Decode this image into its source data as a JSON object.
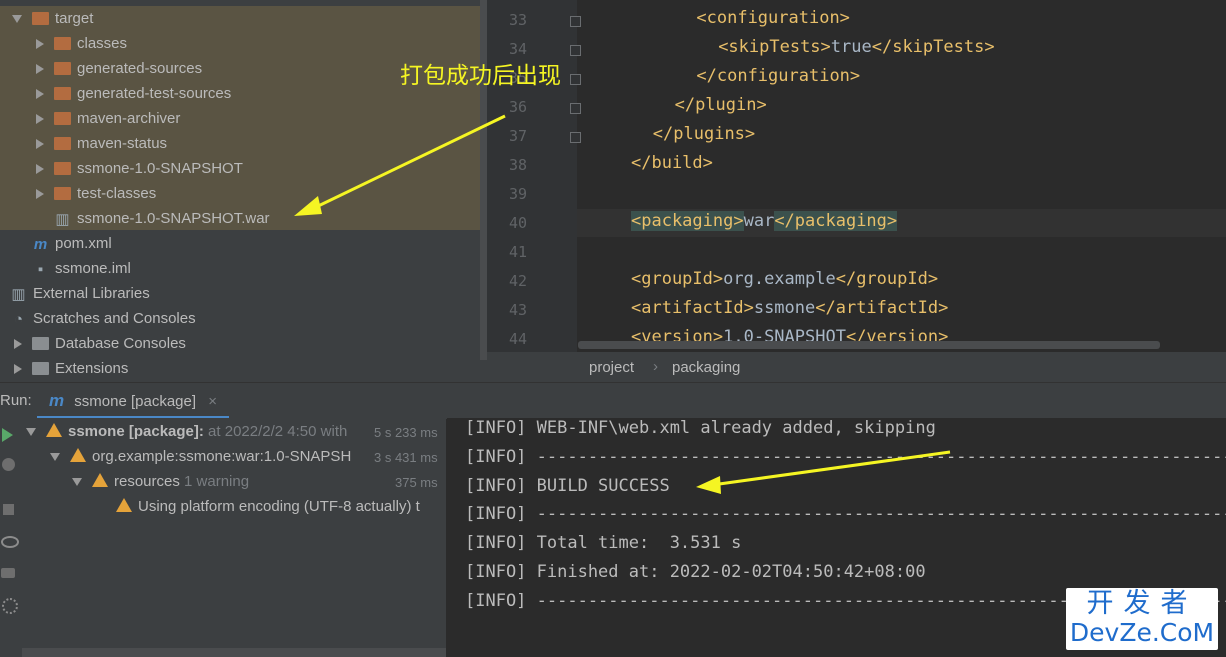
{
  "project_tree": {
    "items": [
      {
        "label": "target",
        "depth": 0,
        "arrow": "down",
        "icon": "folder-icon"
      },
      {
        "label": "classes",
        "depth": 1,
        "arrow": "right",
        "icon": "folder-icon"
      },
      {
        "label": "generated-sources",
        "depth": 1,
        "arrow": "right",
        "icon": "folder-icon"
      },
      {
        "label": "generated-test-sources",
        "depth": 1,
        "arrow": "right",
        "icon": "folder-icon"
      },
      {
        "label": "maven-archiver",
        "depth": 1,
        "arrow": "right",
        "icon": "folder-icon"
      },
      {
        "label": "maven-status",
        "depth": 1,
        "arrow": "right",
        "icon": "folder-icon"
      },
      {
        "label": "ssmone-1.0-SNAPSHOT",
        "depth": 1,
        "arrow": "right",
        "icon": "folder-icon"
      },
      {
        "label": "test-classes",
        "depth": 1,
        "arrow": "right",
        "icon": "folder-icon"
      },
      {
        "label": "ssmone-1.0-SNAPSHOT.war",
        "depth": 1,
        "arrow": "none",
        "icon": "war-file-icon"
      },
      {
        "label": "pom.xml",
        "depth": 0,
        "arrow": "none",
        "icon": "maven-icon"
      },
      {
        "label": "ssmone.iml",
        "depth": 0,
        "arrow": "none",
        "icon": "module-file-icon"
      },
      {
        "label": "External Libraries",
        "depth": -1,
        "arrow": "none",
        "icon": "libraries-icon"
      },
      {
        "label": "Scratches and Consoles",
        "depth": -1,
        "arrow": "none",
        "icon": "scratches-icon"
      },
      {
        "label": "Database Consoles",
        "depth": 0,
        "arrow": "right",
        "icon": "folder-icon"
      },
      {
        "label": "Extensions",
        "depth": 0,
        "arrow": "right",
        "icon": "folder-icon"
      }
    ]
  },
  "annotation": "打包成功后出现",
  "editor": {
    "lines": [
      {
        "n": "33",
        "text": "<configuration>",
        "indent": 6
      },
      {
        "n": "34",
        "text": "<skipTests>true</skipTests>",
        "indent": 8
      },
      {
        "n": "35",
        "text": "</configuration>",
        "indent": 6
      },
      {
        "n": "36",
        "text": "</plugin>",
        "indent": 4
      },
      {
        "n": "37",
        "text": "</plugins>",
        "indent": 2
      },
      {
        "n": "38",
        "text": "</build>",
        "indent": 0
      },
      {
        "n": "39",
        "text": "",
        "indent": 0
      },
      {
        "n": "40",
        "text": "<packaging>war</packaging>",
        "indent": 0
      },
      {
        "n": "41",
        "text": "",
        "indent": 0
      },
      {
        "n": "42",
        "text": "<groupId>org.example</groupId>",
        "indent": 0
      },
      {
        "n": "43",
        "text": "<artifactId>ssmone</artifactId>",
        "indent": 0
      },
      {
        "n": "44",
        "text": "<version>1.0-SNAPSHOT</version>",
        "indent": 0
      }
    ]
  },
  "breadcrumb": {
    "items": [
      "project",
      "packaging"
    ]
  },
  "run": {
    "label": "Run:",
    "tab_label": "ssmone [package]",
    "tree": [
      {
        "title": "ssmone [package]:",
        "detail": " at 2022/2/2 4:50 with",
        "time": "5 s 233 ms",
        "bold": true
      },
      {
        "title": "org.example:ssmone:war:1.0-SNAPSH",
        "detail": "",
        "time": "3 s 431 ms",
        "bold": false
      },
      {
        "title": "resources",
        "detail": "  1 warning",
        "time": "375 ms",
        "bold": false
      },
      {
        "title": "Using platform encoding (UTF-8 actually) t",
        "detail": "",
        "time": "",
        "bold": false
      }
    ]
  },
  "console": {
    "lines": [
      "[INFO] WEB-INF\\web.xml already added, skipping",
      "[INFO] ------------------------------------------------------------------------",
      "[INFO] BUILD SUCCESS",
      "[INFO] ------------------------------------------------------------------------",
      "[INFO] Total time:  3.531 s",
      "[INFO] Finished at: 2022-02-02T04:50:42+08:00",
      "[INFO] ------------------------------------------------------------------------"
    ]
  },
  "watermark": {
    "line1": "开发者",
    "line2": "DevZe.CoM"
  },
  "colors": {
    "accent": "#4a88c7",
    "annotation": "#f5f523",
    "warning": "#e5a33a",
    "folder": "#b36c40"
  }
}
